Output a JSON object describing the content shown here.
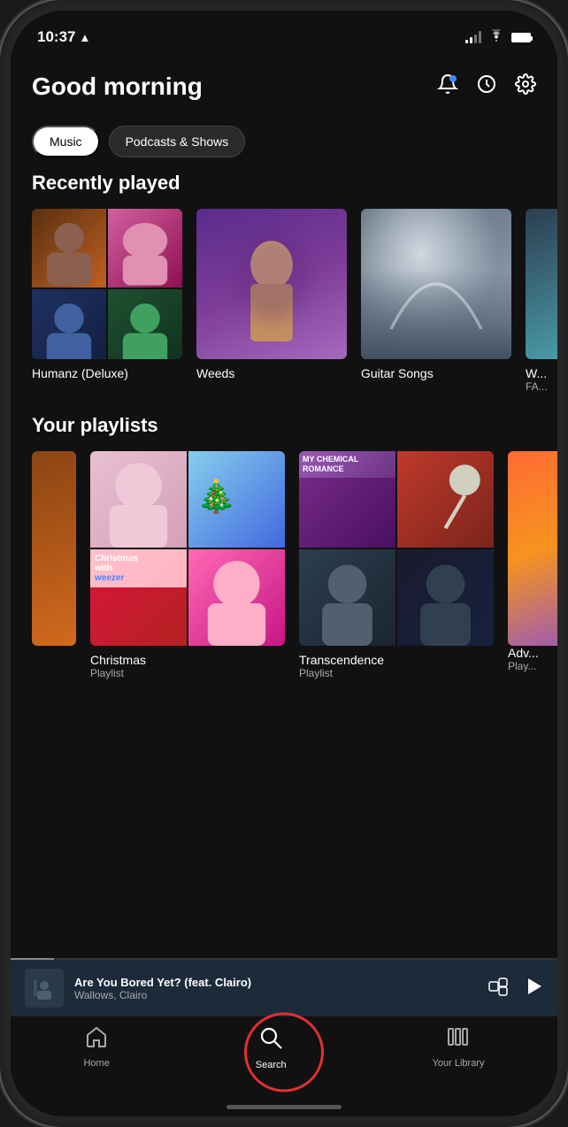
{
  "phone": {
    "status_bar": {
      "time": "10:37",
      "location_icon": "▶",
      "battery": "🔋"
    }
  },
  "header": {
    "greeting": "Good morning",
    "icons": {
      "bell": "🔔",
      "clock": "⏱",
      "settings": "⚙"
    }
  },
  "filter_tabs": {
    "music_label": "Music",
    "podcasts_label": "Podcasts & Shows"
  },
  "recently_played": {
    "section_title": "Recently played",
    "items": [
      {
        "title": "Humanz (Deluxe)",
        "subtitle": ""
      },
      {
        "title": "Weeds",
        "subtitle": ""
      },
      {
        "title": "Guitar Songs",
        "subtitle": ""
      },
      {
        "title": "W... FA...",
        "subtitle": ""
      }
    ]
  },
  "playlists": {
    "section_title": "Your playlists",
    "items": [
      {
        "title": "Christmas",
        "subtitle": "Playlist"
      },
      {
        "title": "Transcendence",
        "subtitle": "Playlist"
      },
      {
        "title": "Adv...",
        "subtitle": "Play... from..."
      }
    ]
  },
  "now_playing": {
    "title": "Are You Bored Yet? (feat. Clairo)",
    "artist": "Wallows, Clairo"
  },
  "bottom_nav": {
    "items": [
      {
        "label": "Home",
        "icon": "home"
      },
      {
        "label": "Search",
        "icon": "search"
      },
      {
        "label": "Your Library",
        "icon": "library"
      }
    ]
  }
}
